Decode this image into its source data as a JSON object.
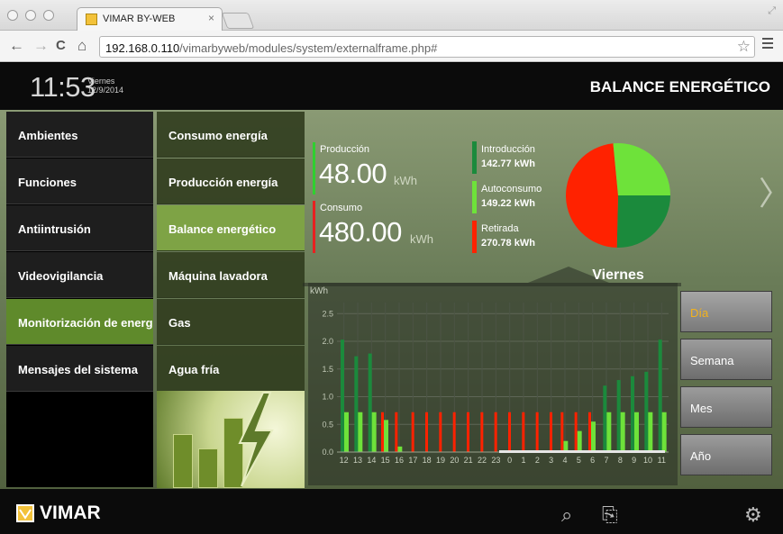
{
  "browser": {
    "tab_title": "VIMAR BY-WEB",
    "tab_close": "×",
    "url_host": "192.168.0.110",
    "url_path": "/vimarbyweb/modules/system/externalframe.php#",
    "back": "←",
    "forward": "→",
    "reload": "C",
    "home": "⌂",
    "star": "☆"
  },
  "header": {
    "time": "11:53",
    "day": "Viernes",
    "date": "12/9/2014",
    "title": "BALANCE ENERGÉTICO"
  },
  "sidebar": {
    "items": [
      {
        "label": "Ambientes"
      },
      {
        "label": "Funciones"
      },
      {
        "label": "Antiintrusión"
      },
      {
        "label": "Videovigilancia"
      },
      {
        "label": "Monitorización de energía"
      },
      {
        "label": "Mensajes del sistema"
      }
    ],
    "active_index": 4
  },
  "submenu": {
    "items": [
      {
        "label": "Consumo energía"
      },
      {
        "label": "Producción energía"
      },
      {
        "label": "Balance energético"
      },
      {
        "label": "Máquina lavadora"
      },
      {
        "label": "Gas"
      },
      {
        "label": "Agua fría"
      }
    ],
    "active_index": 2
  },
  "metrics": {
    "produccion": {
      "label": "Producción",
      "value": "48.00",
      "unit": "kWh",
      "color": "#2fd02f"
    },
    "consumo": {
      "label": "Consumo",
      "value": "480.00",
      "unit": "kWh",
      "color": "#e82020"
    },
    "introduccion": {
      "label": "Introducción",
      "value": "142.77 kWh",
      "color": "#1b8a3c"
    },
    "autoconsumo": {
      "label": "Autoconsumo",
      "value": "149.22 kWh",
      "color": "#6ee23a"
    },
    "retirada": {
      "label": "Retirada",
      "value": "270.78 kWh",
      "color": "#ff2200"
    }
  },
  "pie": {
    "slices": [
      {
        "name": "Introducción",
        "value": 142.77,
        "color": "#1b8a3c"
      },
      {
        "name": "Retirada",
        "value": 270.78,
        "color": "#ff2200"
      },
      {
        "name": "Autoconsumo",
        "value": 149.22,
        "color": "#6ee23a"
      }
    ]
  },
  "periods": {
    "buttons": [
      {
        "label": "Día"
      },
      {
        "label": "Semana"
      },
      {
        "label": "Mes"
      },
      {
        "label": "Año"
      }
    ],
    "active_index": 0,
    "active_color": "#f4b21c"
  },
  "footer": {
    "brand": "VIMAR",
    "icon1": "search-list-icon",
    "icon2": "export-icon",
    "icon3": "settings-icon"
  },
  "chart_data": {
    "type": "bar",
    "title": "Viernes",
    "ylabel": "kWh",
    "ylim": [
      0,
      2.7
    ],
    "yticks": [
      "0.0",
      "0.5",
      "1.0",
      "1.5",
      "2.0",
      "2.5"
    ],
    "categories": [
      "12",
      "13",
      "14",
      "15",
      "16",
      "17",
      "18",
      "19",
      "20",
      "21",
      "22",
      "23",
      "0",
      "1",
      "2",
      "3",
      "4",
      "5",
      "6",
      "7",
      "8",
      "9",
      "10",
      "11"
    ],
    "grid": true,
    "series": [
      {
        "color": "#1b8a3c",
        "values": [
          2.03,
          1.73,
          1.78,
          0,
          0,
          0,
          0,
          0,
          0,
          0,
          0,
          0,
          0,
          0,
          0,
          0,
          0,
          0,
          0,
          1.2,
          1.3,
          1.37,
          1.45,
          2.03
        ]
      },
      {
        "color": "#6ee23a",
        "values": [
          0.72,
          0.72,
          0.72,
          0.58,
          0.1,
          0,
          0,
          0,
          0,
          0,
          0,
          0,
          0,
          0,
          0,
          0,
          0.2,
          0.38,
          0.55,
          0.72,
          0.72,
          0.72,
          0.72,
          0.72
        ]
      },
      {
        "color": "#ff2200",
        "values": [
          0,
          0,
          0,
          0.72,
          0.72,
          0.72,
          0.72,
          0.72,
          0.72,
          0.72,
          0.72,
          0.72,
          0.72,
          0.72,
          0.72,
          0.72,
          0.72,
          0.72,
          0.72,
          0,
          0,
          0,
          0,
          0
        ]
      }
    ]
  }
}
